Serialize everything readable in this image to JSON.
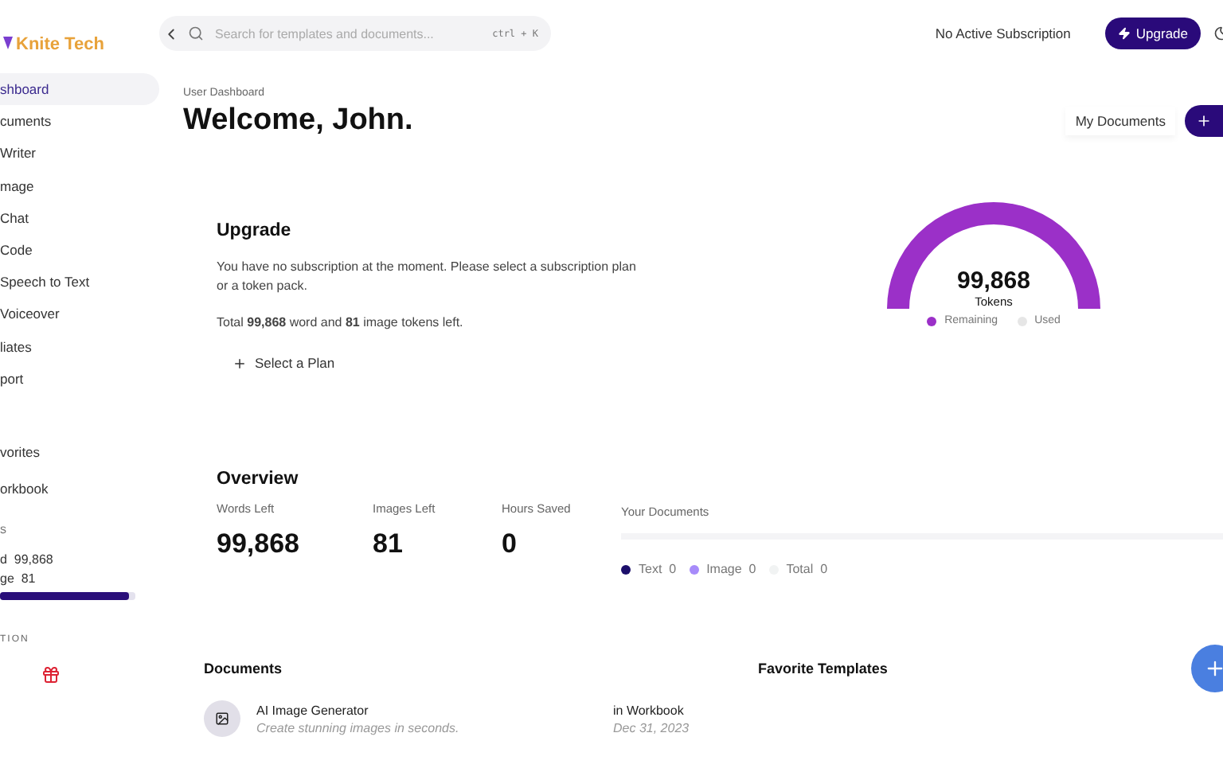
{
  "sidebar": {
    "logo": "Knite Tech",
    "items": [
      {
        "label": "shboard",
        "selected": true
      },
      {
        "label": "cuments",
        "selected": false
      },
      {
        "label": "Writer",
        "selected": false
      },
      {
        "label": "mage",
        "selected": false
      },
      {
        "label": "Chat",
        "selected": false
      },
      {
        "label": "Code",
        "selected": false
      },
      {
        "label": "Speech to Text",
        "selected": false
      },
      {
        "label": "Voiceover",
        "selected": false
      },
      {
        "label": "liates",
        "selected": false
      },
      {
        "label": "port",
        "selected": false
      }
    ],
    "links": [
      {
        "label": "vorites",
        "selected": false
      },
      {
        "label": "orkbook",
        "selected": false
      }
    ],
    "credits_heading": "s",
    "credits": [
      {
        "label": "d",
        "value": "99,868"
      },
      {
        "label": "ge",
        "value": "81"
      }
    ],
    "credits_bar": {
      "level": 0.95
    },
    "section_heading": "TION"
  },
  "topbar": {
    "search": {
      "placeholder": "Search for templates and documents...",
      "shortcut": "ctrl + K"
    },
    "subscription": "No Active Subscription",
    "upgrade": "Upgrade"
  },
  "header": {
    "breadcrumb": "User Dashboard",
    "title": "Welcome, John.",
    "my_documents": "My Documents"
  },
  "upgrade": {
    "title": "Upgrade",
    "message": "You have no subscription at the moment. Please select a subscription plan or a token pack.",
    "tokens_note": "Total **99,868** word and **81** image tokens left.",
    "action": "Select a Plan",
    "gauge": {
      "value": "99,868",
      "unit": "Tokens",
      "legend": [
        {
          "label": "Remaining",
          "color": "#9b30c8"
        },
        {
          "label": "Used",
          "color": "#e6e6e6"
        }
      ]
    }
  },
  "overview": {
    "title": "Overview",
    "stats": [
      {
        "label": "Words Left",
        "value": "99,868"
      },
      {
        "label": "Images Left",
        "value": "81"
      },
      {
        "label": "Hours Saved",
        "value": "0"
      }
    ],
    "your_documents": {
      "title": "Your Documents",
      "legend": [
        {
          "label": "Text",
          "value": "0",
          "color": "#1c0f6b"
        },
        {
          "label": "Image",
          "value": "0",
          "color": "#a78bfa"
        },
        {
          "label": "Total",
          "value": "0",
          "color": "#f1f3f3"
        }
      ]
    }
  },
  "documents": {
    "title": "Documents",
    "rows": [
      {
        "name": "AI Image Generator",
        "description": "Create stunning images in seconds.",
        "location": "in Workbook",
        "date": "Dec 31, 2023"
      }
    ]
  },
  "favorites": {
    "title": "Favorite Templates"
  }
}
